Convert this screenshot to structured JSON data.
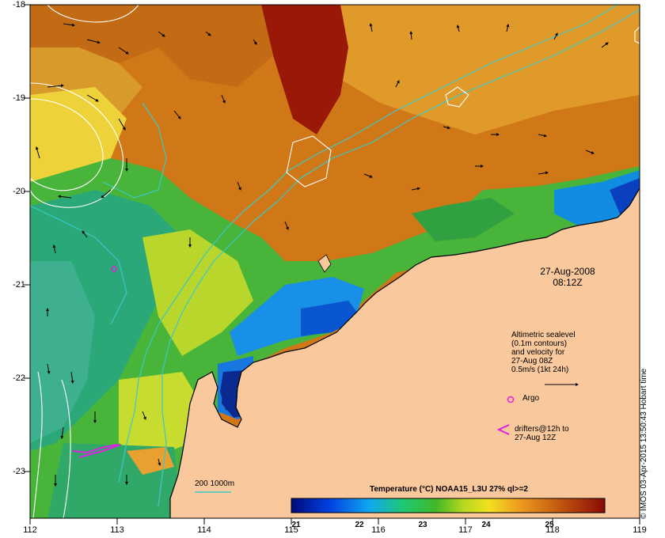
{
  "map": {
    "x_ticks": [
      "112",
      "113",
      "114",
      "115",
      "116",
      "117",
      "118",
      "119"
    ],
    "y_ticks": [
      "-18",
      "-19",
      "-20",
      "-21",
      "-22",
      "-23"
    ],
    "date_line1": "27-Aug-2008",
    "date_line2": "08:12Z",
    "legend_lines": [
      "Altimetric sealevel",
      "(0.1m contours)",
      "and velocity for",
      "27-Aug 08Z",
      "0.5m/s (1kt 24h)"
    ],
    "argo_label": "Argo",
    "drifter_line1": "drifters@12h to",
    "drifter_line2": "27-Aug 12Z",
    "depth_label": "200  1000m",
    "colorbar_title": "Temperature (°C) NOAA15_L3U 27% ql>=2",
    "colorbar_ticks": [
      "21",
      "22",
      "23",
      "24",
      "25"
    ],
    "credit": "© IMOS 03-Apr-2015 13:50:43 Hobart time",
    "colors": {
      "land": "#f9c89c",
      "isobath": "#3cc8c8",
      "argo": "#e020e0",
      "drifter": "#e020e0"
    }
  }
}
